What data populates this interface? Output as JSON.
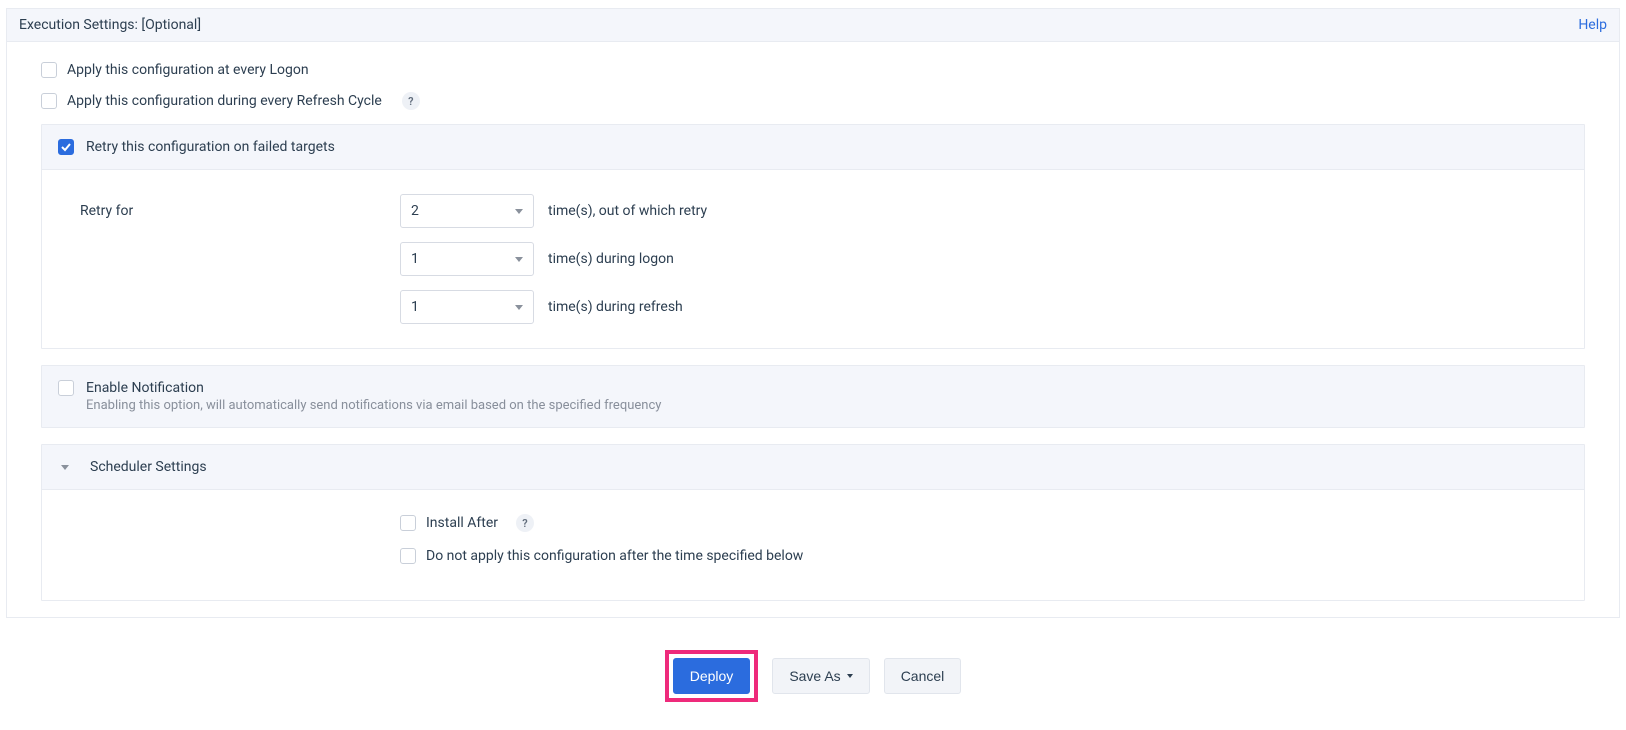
{
  "section": {
    "title": "Execution Settings: [Optional]",
    "help": "Help"
  },
  "settings": {
    "apply_logon_label": "Apply this configuration at every Logon",
    "apply_refresh_label": "Apply this configuration during every Refresh Cycle",
    "retry_label": "Retry this configuration on failed targets",
    "retry_for_label": "Retry for",
    "retry_total_value": "2",
    "retry_total_suffix": "time(s), out of which retry",
    "retry_logon_value": "1",
    "retry_logon_suffix": "time(s) during logon",
    "retry_refresh_value": "1",
    "retry_refresh_suffix": "time(s) during refresh"
  },
  "notification": {
    "title": "Enable Notification",
    "subtitle": "Enabling this option, will automatically send notifications via email based on the specified frequency"
  },
  "scheduler": {
    "title": "Scheduler Settings",
    "install_after_label": "Install After",
    "no_apply_label": "Do not apply this configuration after the time specified below"
  },
  "buttons": {
    "deploy": "Deploy",
    "save_as": "Save As",
    "cancel": "Cancel"
  },
  "help_icon": "?"
}
